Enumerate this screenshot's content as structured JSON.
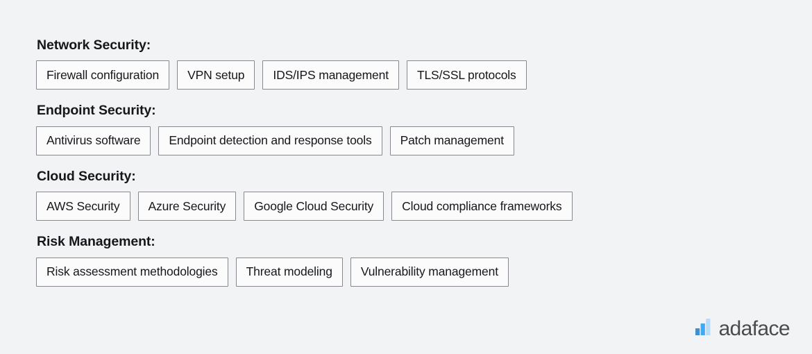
{
  "background_color": "#f2f3f5",
  "sections": [
    {
      "heading": "Network Security:",
      "tags": [
        "Firewall configuration",
        "VPN setup",
        "IDS/IPS management",
        "TLS/SSL protocols"
      ]
    },
    {
      "heading": "Endpoint Security:",
      "tags": [
        "Antivirus software",
        "Endpoint detection and response tools",
        "Patch management"
      ]
    },
    {
      "heading": "Cloud Security:",
      "tags": [
        "AWS Security",
        "Azure Security",
        "Google Cloud Security",
        "Cloud compliance frameworks"
      ]
    },
    {
      "heading": "Risk Management:",
      "tags": [
        "Risk assessment methodologies",
        "Threat modeling",
        "Vulnerability management"
      ]
    }
  ],
  "logo": {
    "wordmark": "adaface",
    "icon": "bar-chart-logo-icon",
    "wordmark_color": "#4b4b4d",
    "bar_colors": [
      "#3e8ed0",
      "#3fa9f5",
      "#b8dcfb"
    ]
  }
}
